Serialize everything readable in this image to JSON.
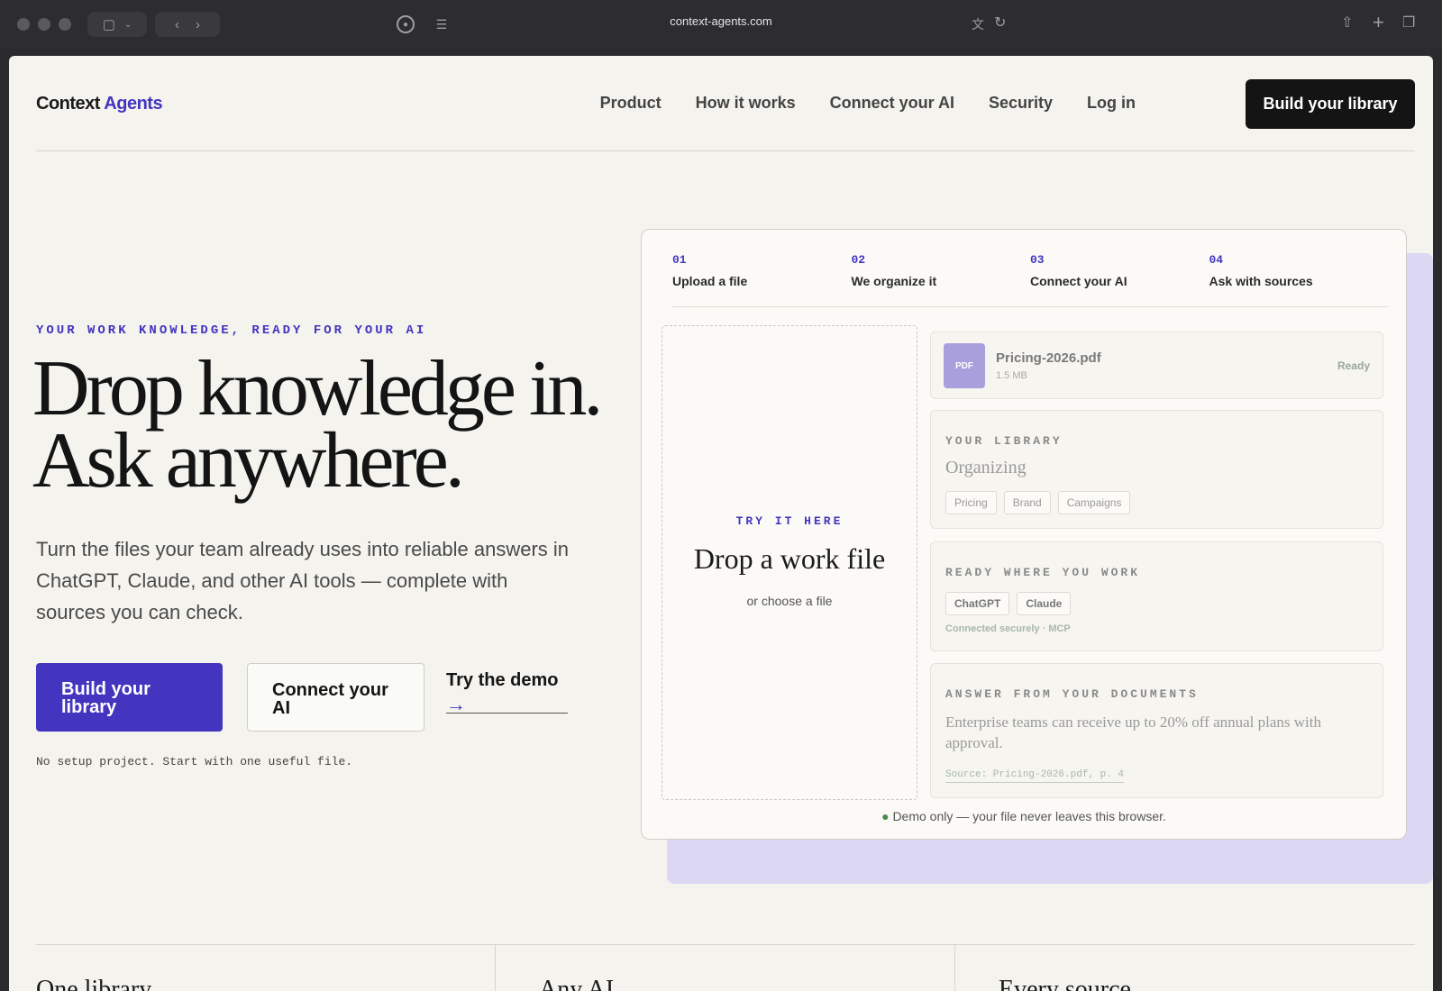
{
  "browser": {
    "url": "context-agents.com"
  },
  "nav": {
    "logo_main": "Context",
    "logo_accent": "Agents",
    "links": [
      "Product",
      "How it works",
      "Connect your AI",
      "Security",
      "Log in"
    ],
    "cta": "Build your library"
  },
  "hero": {
    "eyebrow": "YOUR WORK KNOWLEDGE, READY FOR YOUR AI",
    "headline_line1": "Drop knowledge in.",
    "headline_line2": "Ask anywhere.",
    "subtitle": "Turn the files your team already uses into reliable answers in ChatGPT, Claude, and other AI tools — complete with sources you can check.",
    "primary_cta": "Build your library",
    "secondary_cta": "Connect your AI",
    "demo_link": "Try the demo",
    "demo_arrow": "→",
    "note": "No setup project. Start with one useful file."
  },
  "demo": {
    "steps": [
      {
        "num": "01",
        "label": "Upload a file"
      },
      {
        "num": "02",
        "label": "We organize it"
      },
      {
        "num": "03",
        "label": "Connect your AI"
      },
      {
        "num": "04",
        "label": "Ask with sources"
      }
    ],
    "dropzone": {
      "eyebrow": "TRY IT HERE",
      "title": "Drop a work file",
      "subtitle": "or choose a file"
    },
    "file": {
      "badge": "PDF",
      "name": "Pricing-2026.pdf",
      "size": "1.5 MB",
      "status": "Ready"
    },
    "library": {
      "label": "YOUR LIBRARY",
      "state": "Organizing",
      "tags": [
        "Pricing",
        "Brand",
        "Campaigns"
      ]
    },
    "work": {
      "label": "READY WHERE YOU WORK",
      "tools": [
        "ChatGPT",
        "Claude"
      ],
      "connected": "Connected securely · MCP"
    },
    "answer": {
      "label": "ANSWER FROM YOUR DOCUMENTS",
      "text": "Enterprise teams can receive up to 20% off annual plans with approval.",
      "source": "Source: Pricing-2026.pdf, p. 4"
    },
    "note_dot": "●",
    "note": "Demo only — your file never leaves this browser."
  },
  "features": [
    "One library",
    "Any AI",
    "Every source"
  ]
}
